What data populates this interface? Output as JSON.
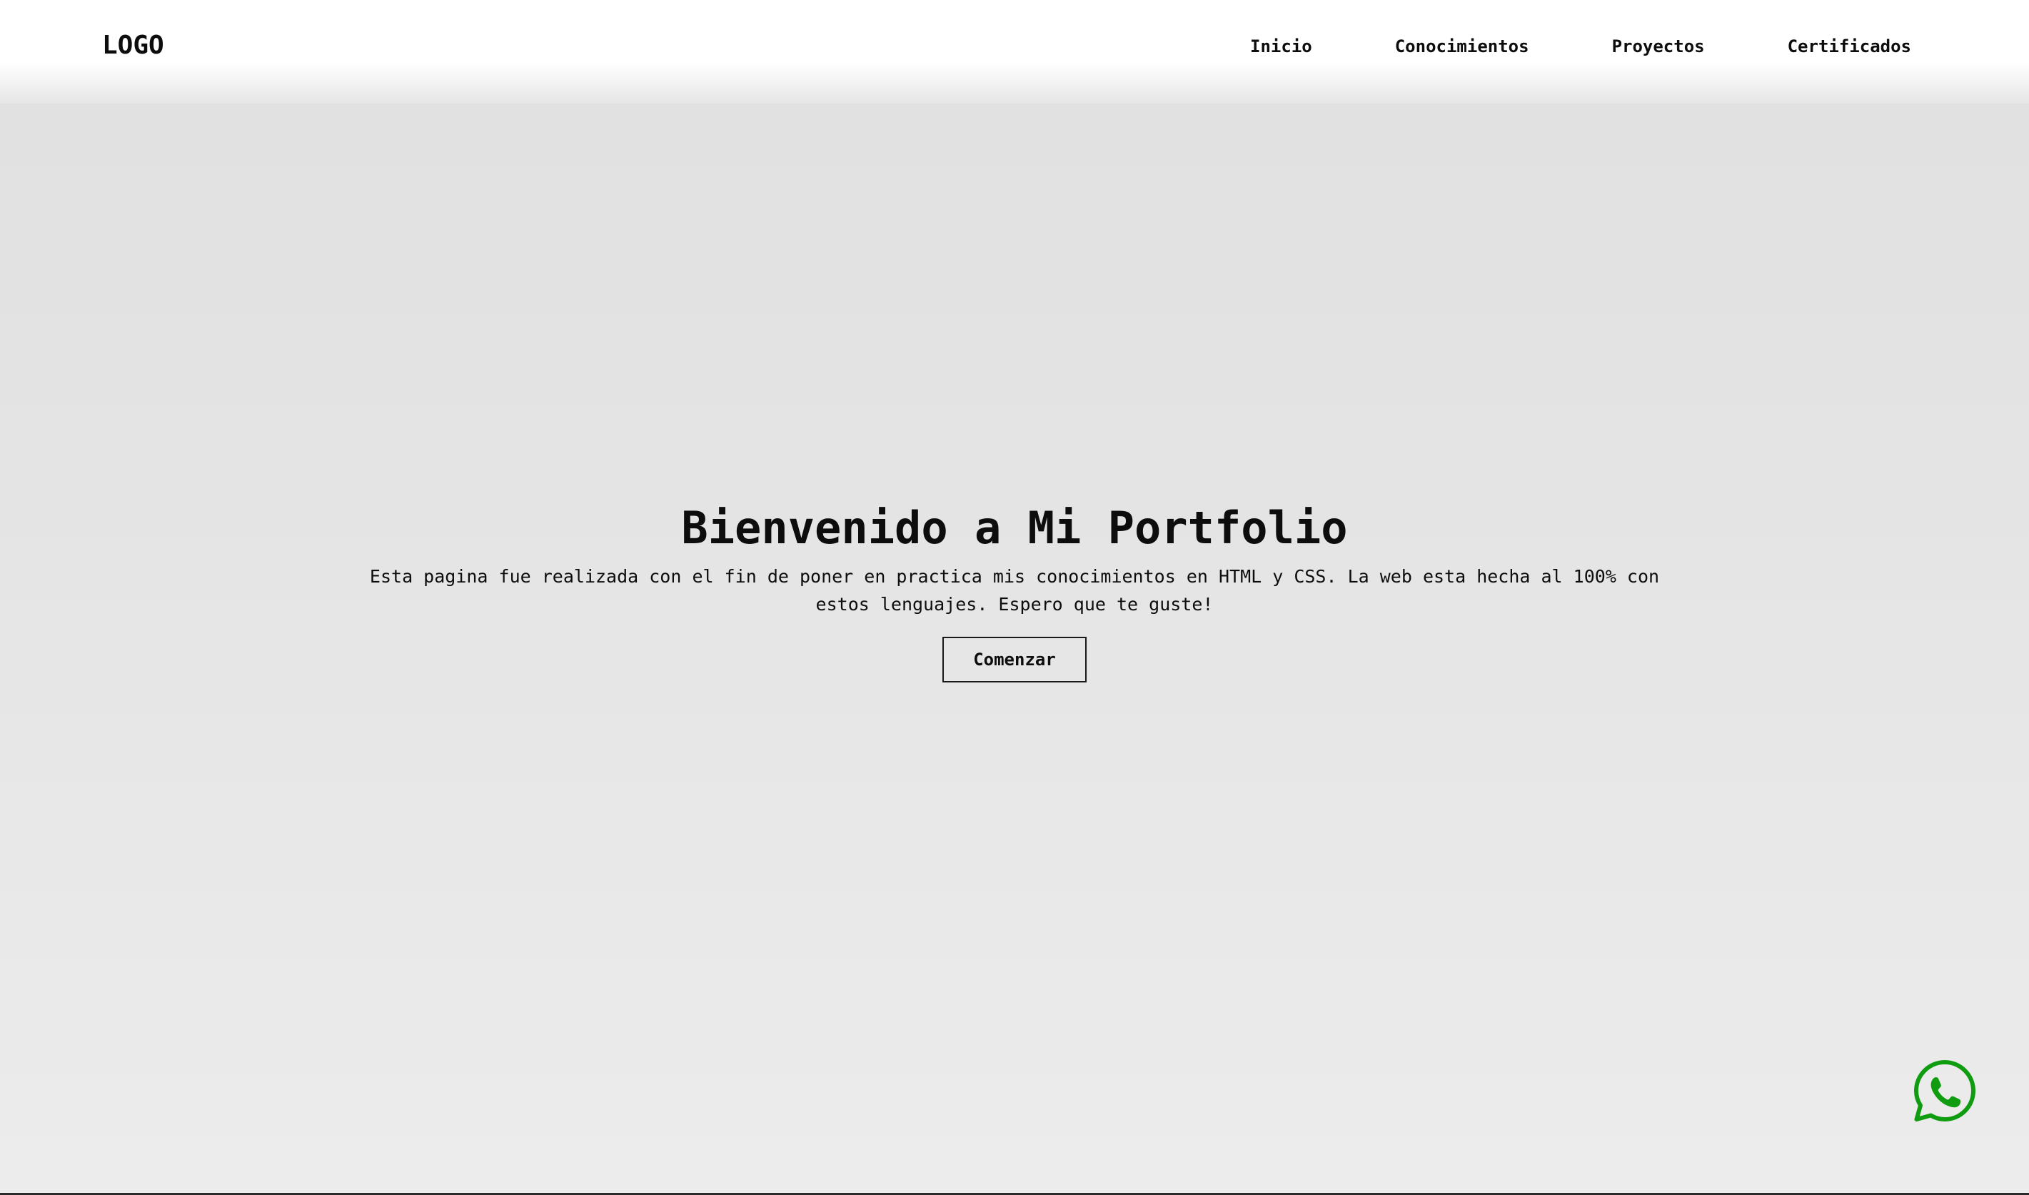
{
  "header": {
    "logo": "LOGO",
    "nav": [
      {
        "label": "Inicio"
      },
      {
        "label": "Conocimientos"
      },
      {
        "label": "Proyectos"
      },
      {
        "label": "Certificados"
      }
    ]
  },
  "hero": {
    "title": "Bienvenido a Mi Portfolio",
    "text": "Esta pagina fue realizada con el fin de poner en practica mis conocimientos en HTML y CSS. La web esta hecha al 100% con estos lenguajes. Espero que te guste!",
    "button_label": "Comenzar"
  },
  "floating": {
    "whatsapp_icon": "whatsapp-icon",
    "whatsapp_color": "#109c10"
  }
}
